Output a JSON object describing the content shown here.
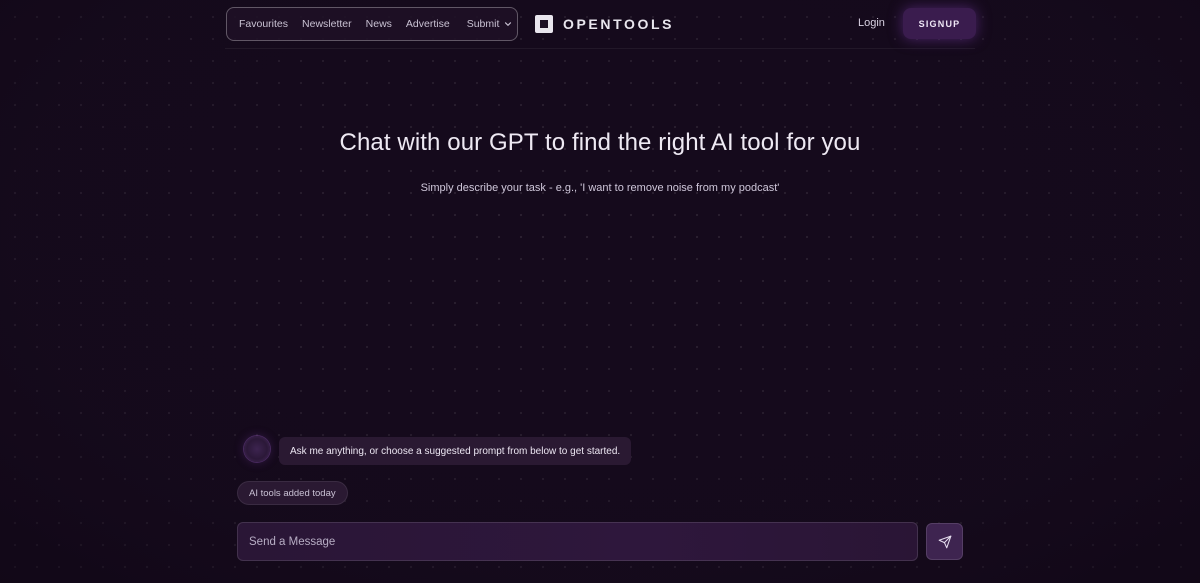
{
  "nav": {
    "items": [
      {
        "label": "Favourites"
      },
      {
        "label": "Newsletter"
      },
      {
        "label": "News"
      },
      {
        "label": "Advertise"
      },
      {
        "label": "Submit",
        "icon": "chevron-down-icon"
      }
    ]
  },
  "brand": {
    "name": "OPENTOOLS",
    "icon": "logo-icon"
  },
  "auth": {
    "login_label": "Login",
    "signup_label": "SIGNUP"
  },
  "hero": {
    "title": "Chat with our GPT to find the right AI tool for you",
    "subtitle": "Simply describe your task - e.g., 'I want to remove noise from my podcast'"
  },
  "chat": {
    "bot_message": "Ask me anything, or choose a suggested prompt from below to get started.",
    "suggestions": [
      {
        "label": "AI tools added today"
      }
    ],
    "input_placeholder": "Send a Message",
    "input_value": "",
    "send_icon": "send-icon"
  },
  "colors": {
    "background": "#150a1c",
    "accent": "#3a1c4e",
    "bubble": "#2a1932"
  }
}
